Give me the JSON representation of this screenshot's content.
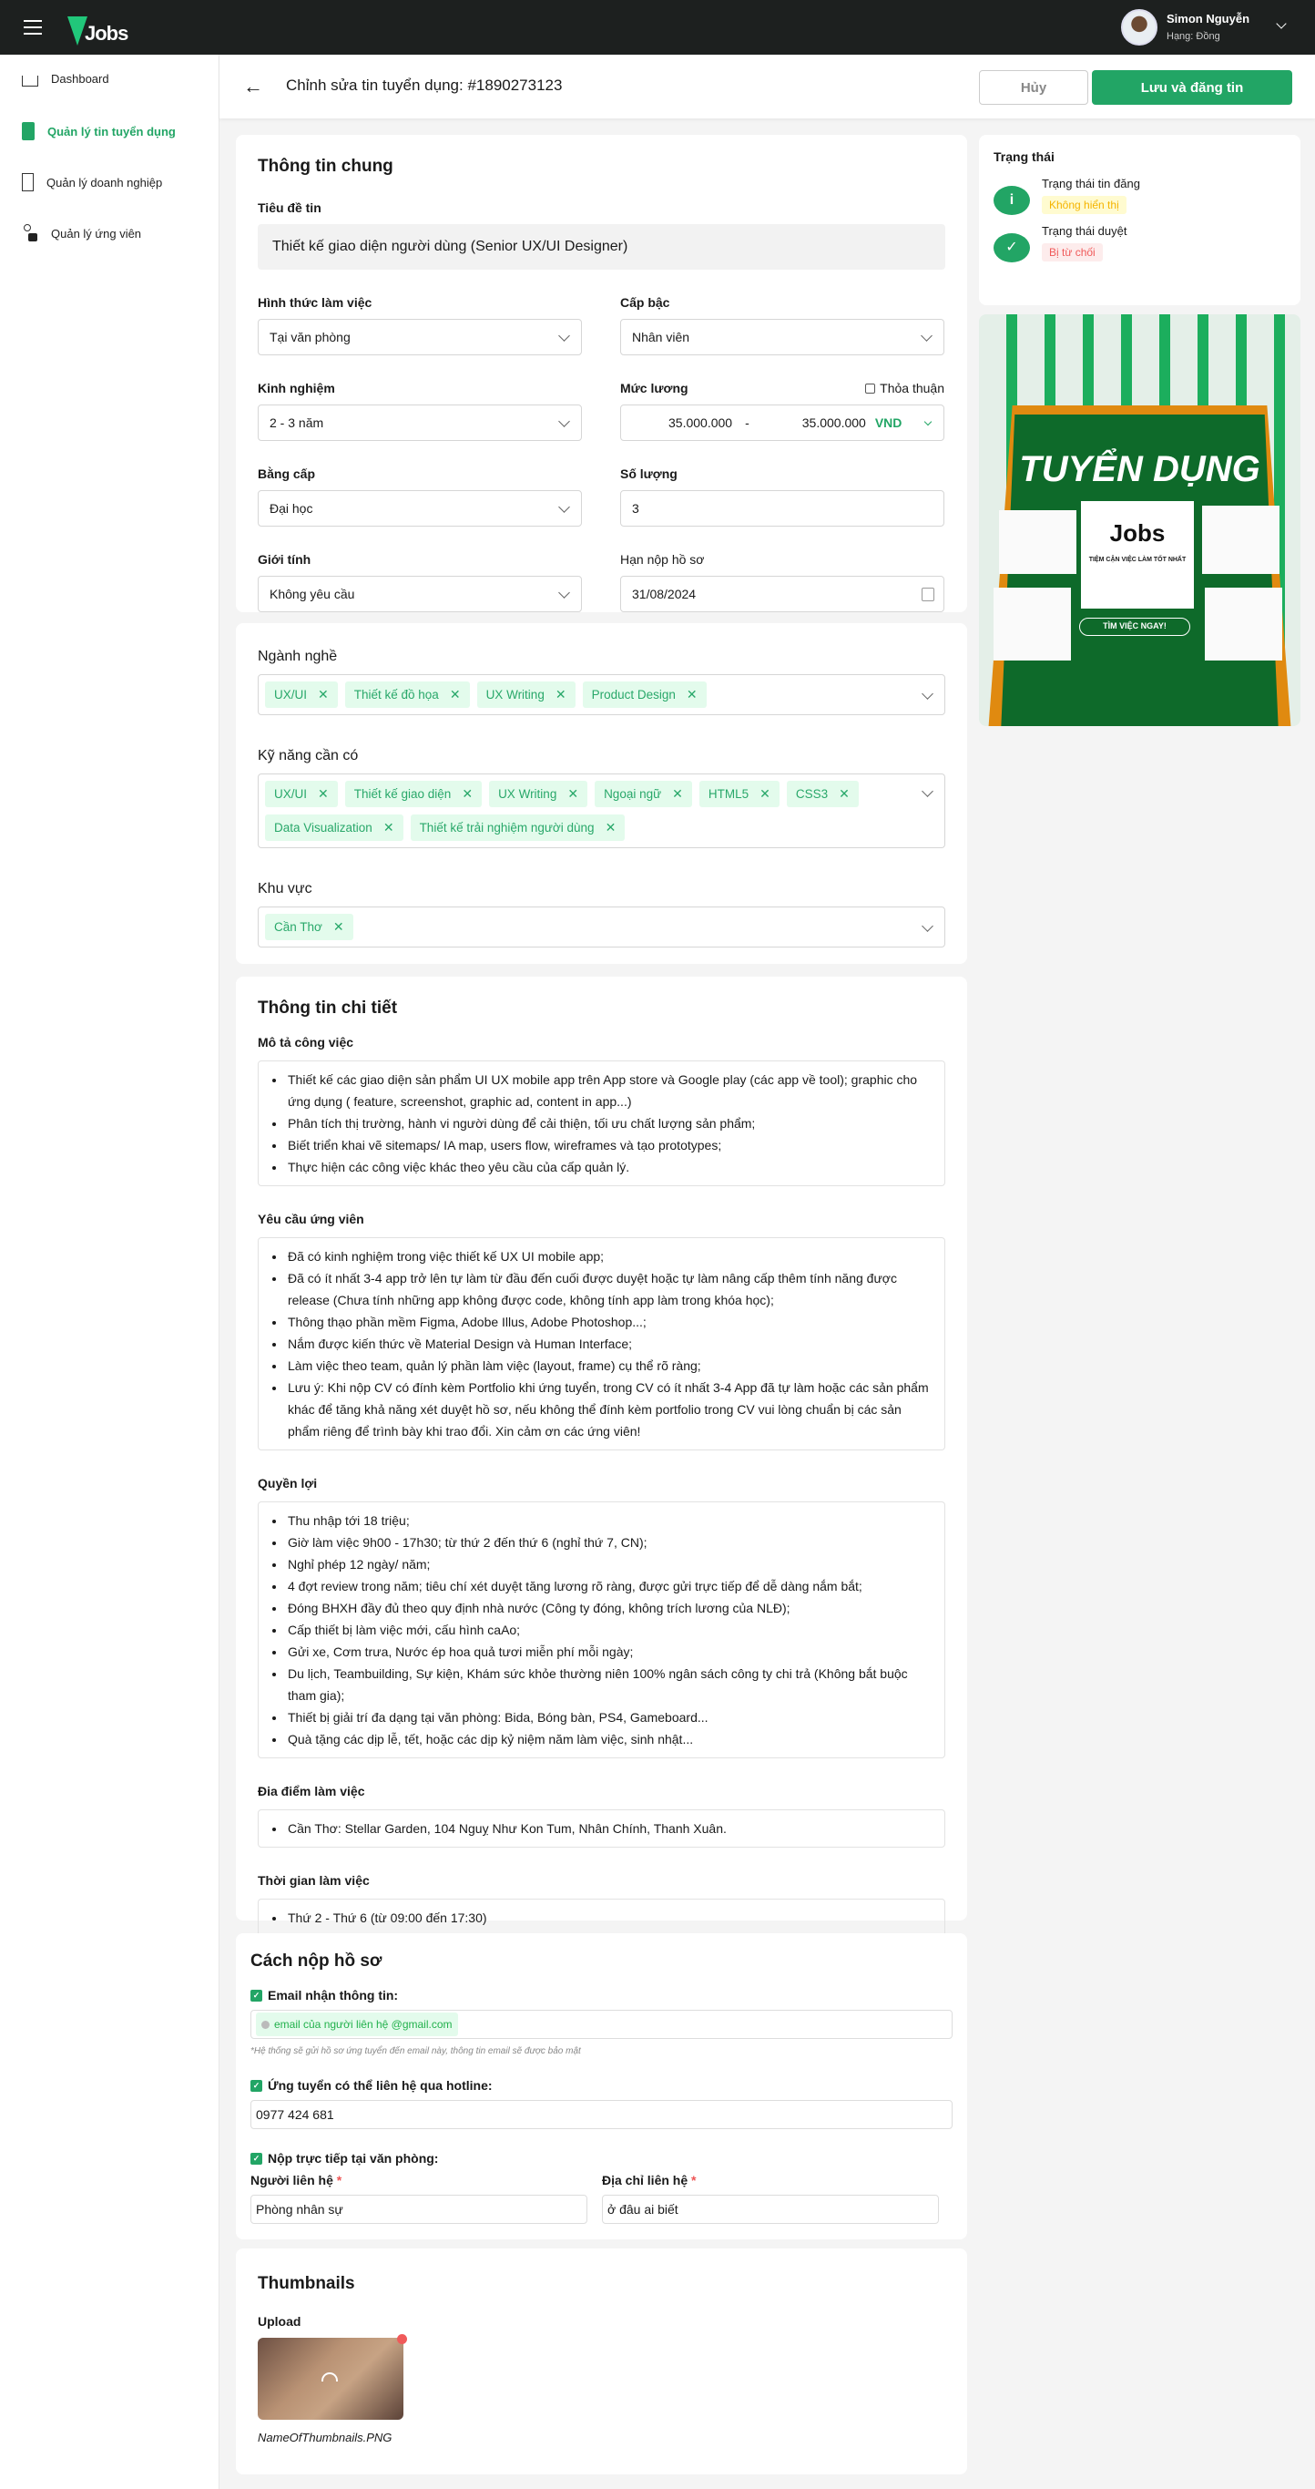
{
  "header": {
    "logo": "Jobs",
    "user_name": "Simon Nguyễn",
    "user_rank": "Hạng: Đồng"
  },
  "sidebar": {
    "items": [
      {
        "label": "Dashboard",
        "icon": "home-icon"
      },
      {
        "label": "Quản lý tin tuyển dụng",
        "icon": "document-edit-icon",
        "active": true
      },
      {
        "label": "Quản lý doanh nghiệp",
        "icon": "building-icon"
      },
      {
        "label": "Quản lý ứng viên",
        "icon": "user-lock-icon"
      }
    ]
  },
  "toolbar": {
    "title": "Chỉnh sửa tin tuyển dụng: #1890273123",
    "cancel": "Hủy",
    "save": "Lưu và đăng tin"
  },
  "general": {
    "title": "Thông tin chung",
    "post_title_label": "Tiêu đề tin",
    "post_title": "Thiết kế giao diện người dùng (Senior UX/UI Designer)",
    "work_type_label": "Hình thức làm việc",
    "work_type": "Tại văn phòng",
    "level_label": "Cấp bậc",
    "level": "Nhân viên",
    "experience_label": "Kinh nghiệm",
    "experience": "2 - 3 năm",
    "salary_label": "Mức lương",
    "negotiable_label": "Thỏa thuận",
    "negotiable": false,
    "salary_min": "35.000.000",
    "salary_sep": "-",
    "salary_max": "35.000.000",
    "currency": "VND",
    "degree_label": "Bằng cấp",
    "degree": "Đại học",
    "quantity_label": "Số lượng",
    "quantity": "3",
    "gender_label": "Giới tính",
    "gender": "Không yêu cầu",
    "deadline_label": "Hạn nộp hồ sơ",
    "deadline": "31/08/2024"
  },
  "categories": {
    "industry_label": "Ngành nghề",
    "industry": [
      "UX/UI",
      "Thiết kế đồ họa",
      "UX Writing",
      "Product Design"
    ],
    "skills_label": "Kỹ năng cần có",
    "skills": [
      "UX/UI",
      "Thiết kế giao diện",
      "UX Writing",
      "Ngoại ngữ",
      "HTML5",
      "CSS3",
      "Data Visualization",
      "Thiết kế trải nghiệm người dùng"
    ],
    "region_label": "Khu vực",
    "region": [
      "Cần Thơ"
    ]
  },
  "detail": {
    "title": "Thông tin chi tiết",
    "description_label": "Mô tả công việc",
    "description": [
      "Thiết kế các giao diện sản phẩm UI UX mobile app trên App store và Google play (các app về tool); graphic cho ứng dụng ( feature, screenshot, graphic ad, content in app...)",
      "Phân tích thị trường, hành vi người dùng để cải thiện, tối ưu chất lượng sản phẩm;",
      "Biết triển khai vẽ sitemaps/ IA map, users flow, wireframes và tạo prototypes;",
      "Thực hiện các công việc khác theo yêu cầu của cấp quản lý."
    ],
    "requirements_label": "Yêu cầu ứng viên",
    "requirements": [
      "Đã có kinh nghiệm trong việc thiết kế UX UI mobile app;",
      "Đã có ít nhất 3-4 app trở lên tự làm từ đầu đến cuối được duyệt hoặc tự làm nâng cấp thêm tính năng được release (Chưa tính những app không được code, không tính app làm trong khóa học);",
      "Thông thạo phần mềm Figma, Adobe Illus, Adobe Photoshop...;",
      "Nắm được kiến thức về Material Design và Human Interface;",
      "Làm việc theo team, quản lý phần làm việc (layout, frame) cụ thể rõ ràng;",
      "Lưu ý: Khi nộp CV có đính kèm Portfolio khi ứng tuyển, trong CV có ít nhất 3-4 App đã tự làm hoặc các sản phẩm khác để tăng khả năng xét duyệt hồ sơ, nếu không thể đính kèm portfolio trong CV vui lòng chuẩn bị các sản phẩm riêng để trình bày khi trao đổi. Xin cảm ơn các ứng viên!"
    ],
    "benefits_label": "Quyền lợi",
    "benefits": [
      "Thu nhập tới 18 triệu;",
      "Giờ làm việc 9h00 - 17h30; từ thứ 2 đến thứ 6 (nghỉ thứ 7, CN);",
      "Nghỉ phép 12 ngày/ năm;",
      "4 đợt review trong năm; tiêu chí xét duyệt tăng lương rõ ràng, được gửi trực tiếp để dễ dàng nắm bắt;",
      "Đóng BHXH đầy đủ theo quy định nhà nước (Công ty đóng, không trích lương của NLĐ);",
      "Cấp thiết bị làm việc mới, cấu hình caAo;",
      "Gửi xe, Cơm trưa, Nước ép hoa quả tươi miễn phí mỗi ngày;",
      "Du lịch, Teambuilding, Sự kiện, Khám sức khỏe thường niên 100% ngân sách công ty chi trả (Không bắt buộc tham gia);",
      "Thiết bị giải trí đa dạng tại văn phòng: Bida, Bóng bàn, PS4, Gameboard...",
      "Quà tặng các dịp lễ, tết, hoặc các dịp kỷ niệm năm làm việc, sinh nhật..."
    ],
    "location_label": "Đia điểm làm việc",
    "location": [
      "Cần Thơ: Stellar Garden, 104 Nguỵ Như Kon Tum, Nhân Chính, Thanh Xuân."
    ],
    "time_label": "Thời gian làm việc",
    "time": [
      "Thứ 2 - Thứ 6 (từ 09:00 đến 17:30)"
    ]
  },
  "apply": {
    "title": "Cách nộp hồ sơ",
    "email_label": "Email nhận thông tin:",
    "email": "email của người liên hệ @gmail.com",
    "email_hint": "*Hệ thống sẽ gửi hồ sơ ứng tuyển đến email này, thông tin email sẽ được bảo mật",
    "hotline_label": "Ứng tuyển có thể liên hệ qua hotline:",
    "hotline": "0977 424 681",
    "office_label": "Nộp trực tiếp tại văn phòng:",
    "contact_label": "Người liên hệ",
    "contact": "Phòng nhân sự",
    "address_label": "Địa chỉ liên hệ",
    "address": "ở đâu ai biết",
    "required_mark": "*"
  },
  "thumbnails": {
    "title": "Thumbnails",
    "upload_label": "Upload",
    "file_name": "NameOfThumbnails.PNG"
  },
  "status": {
    "title": "Trạng thái",
    "post_status_label": "Trạng thái tin đăng",
    "post_status": "Không hiển thị",
    "review_status_label": "Trạng thái duyệt",
    "review_status": "Bị từ chối"
  },
  "banner": {
    "headline": "TUYỂN DỤNG",
    "logo": "Jobs",
    "tagline": "TIỆM CẬN VIỆC LÀM TỐT NHẤT",
    "cta": "TÌM VIỆC NGAY!"
  },
  "colors": {
    "brand": "#22a565",
    "header_bg": "#1d201f",
    "tag_bg": "#e3fbec",
    "warning": "#f5b400",
    "danger": "#f05a5a"
  }
}
